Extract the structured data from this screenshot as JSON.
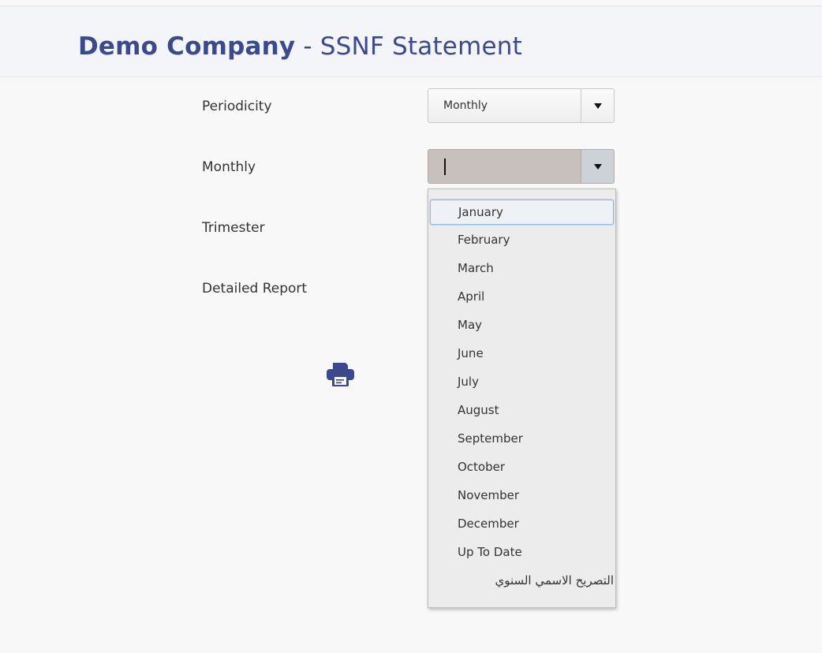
{
  "header": {
    "company": "Demo Company",
    "separator": " - ",
    "report_title": "SSNF Statement"
  },
  "form": {
    "periodicity_label": "Periodicity",
    "monthly_label": "Monthly",
    "trimester_label": "Trimester",
    "detailed_report_label": "Detailed Report",
    "periodicity_value": "Monthly",
    "monthly_value": ""
  },
  "month_options": [
    "January",
    "February",
    "March",
    "April",
    "May",
    "June",
    "July",
    "August",
    "September",
    "October",
    "November",
    "December",
    "Up To Date",
    "التصريح الاسمي السنوي"
  ],
  "highlighted_option": "January",
  "colors": {
    "title": "#3b4a8f",
    "print_icon": "#3b4a8f",
    "option_focus_border": "#8fb5e0"
  },
  "icons": {
    "print": "print-icon",
    "dropdown": "chevron-down-icon"
  }
}
